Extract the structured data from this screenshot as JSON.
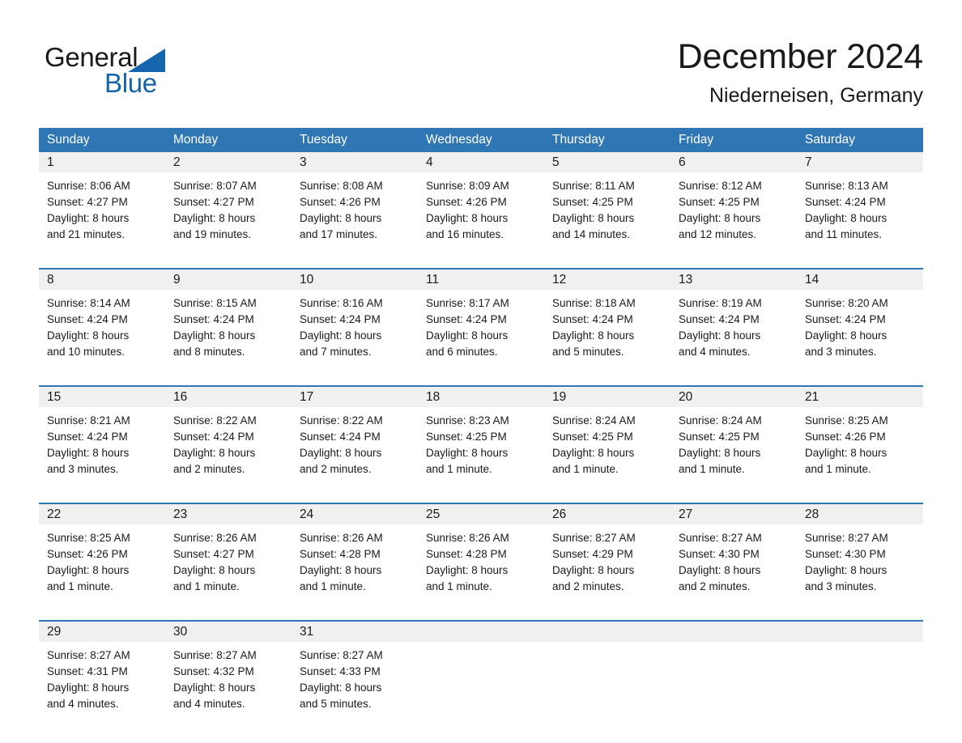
{
  "brand": {
    "name_part1": "General",
    "name_part2": "Blue",
    "triangle_color": "#1565ac",
    "text_color": "#1a1a1a"
  },
  "header": {
    "title": "December 2024",
    "location": "Niederneisen, Germany"
  },
  "theme": {
    "header_blue": "#2f76b4",
    "rule_blue": "#2f76b4",
    "daynum_band": "#f0f0f0",
    "text": "#1a1a1a",
    "header_text": "#ffffff",
    "page_background": "#ffffff"
  },
  "weekdays": [
    "Sunday",
    "Monday",
    "Tuesday",
    "Wednesday",
    "Thursday",
    "Friday",
    "Saturday"
  ],
  "weeks": [
    {
      "days": [
        {
          "num": "1",
          "sunrise": "Sunrise: 8:06 AM",
          "sunset": "Sunset: 4:27 PM",
          "daylight1": "Daylight: 8 hours",
          "daylight2": "and 21 minutes."
        },
        {
          "num": "2",
          "sunrise": "Sunrise: 8:07 AM",
          "sunset": "Sunset: 4:27 PM",
          "daylight1": "Daylight: 8 hours",
          "daylight2": "and 19 minutes."
        },
        {
          "num": "3",
          "sunrise": "Sunrise: 8:08 AM",
          "sunset": "Sunset: 4:26 PM",
          "daylight1": "Daylight: 8 hours",
          "daylight2": "and 17 minutes."
        },
        {
          "num": "4",
          "sunrise": "Sunrise: 8:09 AM",
          "sunset": "Sunset: 4:26 PM",
          "daylight1": "Daylight: 8 hours",
          "daylight2": "and 16 minutes."
        },
        {
          "num": "5",
          "sunrise": "Sunrise: 8:11 AM",
          "sunset": "Sunset: 4:25 PM",
          "daylight1": "Daylight: 8 hours",
          "daylight2": "and 14 minutes."
        },
        {
          "num": "6",
          "sunrise": "Sunrise: 8:12 AM",
          "sunset": "Sunset: 4:25 PM",
          "daylight1": "Daylight: 8 hours",
          "daylight2": "and 12 minutes."
        },
        {
          "num": "7",
          "sunrise": "Sunrise: 8:13 AM",
          "sunset": "Sunset: 4:24 PM",
          "daylight1": "Daylight: 8 hours",
          "daylight2": "and 11 minutes."
        }
      ]
    },
    {
      "days": [
        {
          "num": "8",
          "sunrise": "Sunrise: 8:14 AM",
          "sunset": "Sunset: 4:24 PM",
          "daylight1": "Daylight: 8 hours",
          "daylight2": "and 10 minutes."
        },
        {
          "num": "9",
          "sunrise": "Sunrise: 8:15 AM",
          "sunset": "Sunset: 4:24 PM",
          "daylight1": "Daylight: 8 hours",
          "daylight2": "and 8 minutes."
        },
        {
          "num": "10",
          "sunrise": "Sunrise: 8:16 AM",
          "sunset": "Sunset: 4:24 PM",
          "daylight1": "Daylight: 8 hours",
          "daylight2": "and 7 minutes."
        },
        {
          "num": "11",
          "sunrise": "Sunrise: 8:17 AM",
          "sunset": "Sunset: 4:24 PM",
          "daylight1": "Daylight: 8 hours",
          "daylight2": "and 6 minutes."
        },
        {
          "num": "12",
          "sunrise": "Sunrise: 8:18 AM",
          "sunset": "Sunset: 4:24 PM",
          "daylight1": "Daylight: 8 hours",
          "daylight2": "and 5 minutes."
        },
        {
          "num": "13",
          "sunrise": "Sunrise: 8:19 AM",
          "sunset": "Sunset: 4:24 PM",
          "daylight1": "Daylight: 8 hours",
          "daylight2": "and 4 minutes."
        },
        {
          "num": "14",
          "sunrise": "Sunrise: 8:20 AM",
          "sunset": "Sunset: 4:24 PM",
          "daylight1": "Daylight: 8 hours",
          "daylight2": "and 3 minutes."
        }
      ]
    },
    {
      "days": [
        {
          "num": "15",
          "sunrise": "Sunrise: 8:21 AM",
          "sunset": "Sunset: 4:24 PM",
          "daylight1": "Daylight: 8 hours",
          "daylight2": "and 3 minutes."
        },
        {
          "num": "16",
          "sunrise": "Sunrise: 8:22 AM",
          "sunset": "Sunset: 4:24 PM",
          "daylight1": "Daylight: 8 hours",
          "daylight2": "and 2 minutes."
        },
        {
          "num": "17",
          "sunrise": "Sunrise: 8:22 AM",
          "sunset": "Sunset: 4:24 PM",
          "daylight1": "Daylight: 8 hours",
          "daylight2": "and 2 minutes."
        },
        {
          "num": "18",
          "sunrise": "Sunrise: 8:23 AM",
          "sunset": "Sunset: 4:25 PM",
          "daylight1": "Daylight: 8 hours",
          "daylight2": "and 1 minute."
        },
        {
          "num": "19",
          "sunrise": "Sunrise: 8:24 AM",
          "sunset": "Sunset: 4:25 PM",
          "daylight1": "Daylight: 8 hours",
          "daylight2": "and 1 minute."
        },
        {
          "num": "20",
          "sunrise": "Sunrise: 8:24 AM",
          "sunset": "Sunset: 4:25 PM",
          "daylight1": "Daylight: 8 hours",
          "daylight2": "and 1 minute."
        },
        {
          "num": "21",
          "sunrise": "Sunrise: 8:25 AM",
          "sunset": "Sunset: 4:26 PM",
          "daylight1": "Daylight: 8 hours",
          "daylight2": "and 1 minute."
        }
      ]
    },
    {
      "days": [
        {
          "num": "22",
          "sunrise": "Sunrise: 8:25 AM",
          "sunset": "Sunset: 4:26 PM",
          "daylight1": "Daylight: 8 hours",
          "daylight2": "and 1 minute."
        },
        {
          "num": "23",
          "sunrise": "Sunrise: 8:26 AM",
          "sunset": "Sunset: 4:27 PM",
          "daylight1": "Daylight: 8 hours",
          "daylight2": "and 1 minute."
        },
        {
          "num": "24",
          "sunrise": "Sunrise: 8:26 AM",
          "sunset": "Sunset: 4:28 PM",
          "daylight1": "Daylight: 8 hours",
          "daylight2": "and 1 minute."
        },
        {
          "num": "25",
          "sunrise": "Sunrise: 8:26 AM",
          "sunset": "Sunset: 4:28 PM",
          "daylight1": "Daylight: 8 hours",
          "daylight2": "and 1 minute."
        },
        {
          "num": "26",
          "sunrise": "Sunrise: 8:27 AM",
          "sunset": "Sunset: 4:29 PM",
          "daylight1": "Daylight: 8 hours",
          "daylight2": "and 2 minutes."
        },
        {
          "num": "27",
          "sunrise": "Sunrise: 8:27 AM",
          "sunset": "Sunset: 4:30 PM",
          "daylight1": "Daylight: 8 hours",
          "daylight2": "and 2 minutes."
        },
        {
          "num": "28",
          "sunrise": "Sunrise: 8:27 AM",
          "sunset": "Sunset: 4:30 PM",
          "daylight1": "Daylight: 8 hours",
          "daylight2": "and 3 minutes."
        }
      ]
    },
    {
      "days": [
        {
          "num": "29",
          "sunrise": "Sunrise: 8:27 AM",
          "sunset": "Sunset: 4:31 PM",
          "daylight1": "Daylight: 8 hours",
          "daylight2": "and 4 minutes."
        },
        {
          "num": "30",
          "sunrise": "Sunrise: 8:27 AM",
          "sunset": "Sunset: 4:32 PM",
          "daylight1": "Daylight: 8 hours",
          "daylight2": "and 4 minutes."
        },
        {
          "num": "31",
          "sunrise": "Sunrise: 8:27 AM",
          "sunset": "Sunset: 4:33 PM",
          "daylight1": "Daylight: 8 hours",
          "daylight2": "and 5 minutes."
        },
        {
          "num": "",
          "sunrise": "",
          "sunset": "",
          "daylight1": "",
          "daylight2": ""
        },
        {
          "num": "",
          "sunrise": "",
          "sunset": "",
          "daylight1": "",
          "daylight2": ""
        },
        {
          "num": "",
          "sunrise": "",
          "sunset": "",
          "daylight1": "",
          "daylight2": ""
        },
        {
          "num": "",
          "sunrise": "",
          "sunset": "",
          "daylight1": "",
          "daylight2": ""
        }
      ]
    }
  ]
}
